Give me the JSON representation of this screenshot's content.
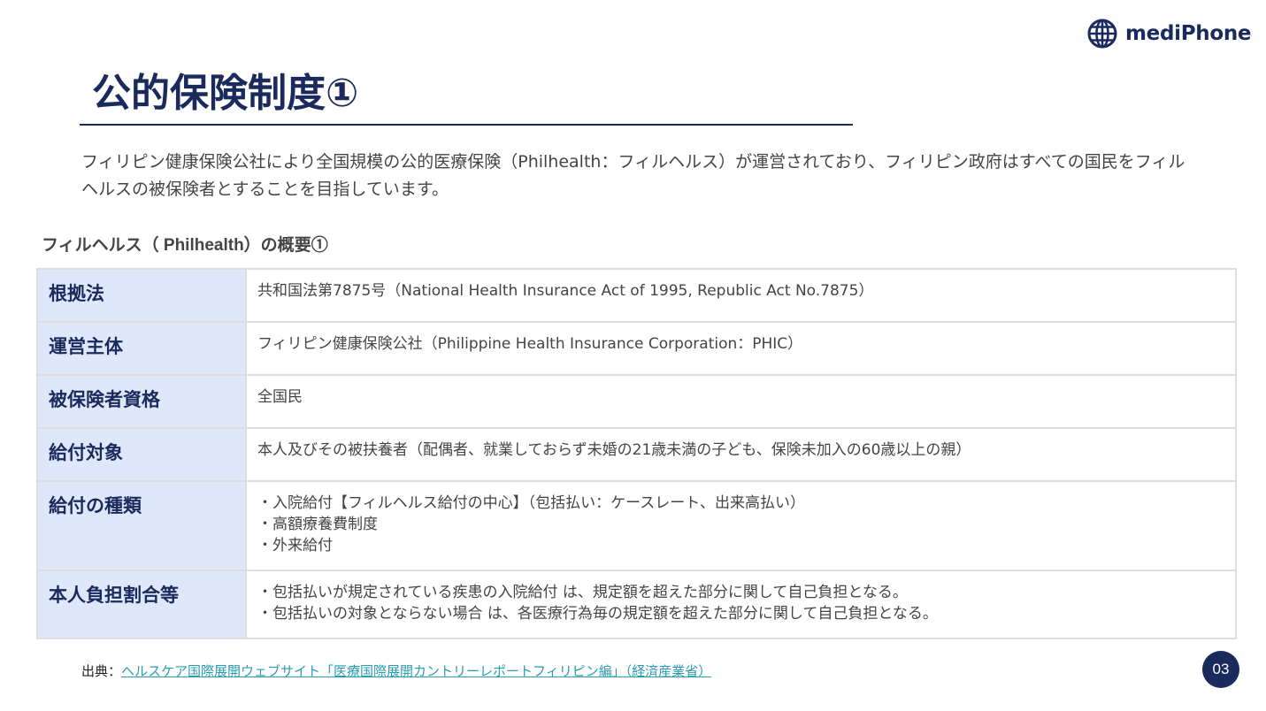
{
  "brand": {
    "name": "mediPhone",
    "icon": "globe-icon",
    "color": "#1b2a5c"
  },
  "page": {
    "title": "公的保険制度①",
    "intro": "フィリピン健康保険公社により全国規模の公的医療保険（Philhealth：フィルヘルス）が運営されており、フィリピン政府はすべての国民をフィルヘルスの被保険者とすることを目指しています。",
    "section_heading": "フィルヘルス（ Philhealth）の概要①",
    "page_number": "03"
  },
  "table": {
    "rows": [
      {
        "label": "根拠法",
        "lines": [
          "共和国法第7875号（National Health Insurance Act of 1995, Republic Act No.7875）"
        ]
      },
      {
        "label": "運営主体",
        "lines": [
          "フィリピン健康保険公社（Philippine Health Insurance Corporation：PHIC）"
        ]
      },
      {
        "label": "被保険者資格",
        "lines": [
          "全国民"
        ]
      },
      {
        "label": "給付対象",
        "lines": [
          "本人及びその被扶養者（配偶者、就業しておらず未婚の21歳未満の子ども、保険未加入の60歳以上の親）"
        ]
      },
      {
        "label": "給付の種類",
        "lines": [
          "・入院給付【フィルヘルス給付の中心】（包括払い：ケースレート、出来高払い）",
          "・高額療養費制度",
          "・外来給付"
        ]
      },
      {
        "label": "本人負担割合等",
        "lines": [
          "・包括払いが規定されている疾患の入院給付 は、規定額を超えた部分に関して自己負担となる。",
          "・包括払いの対象とならない場合 は、各医療行為毎の規定額を超えた部分に関して自己負担となる。"
        ]
      }
    ]
  },
  "source": {
    "prefix": "出典：",
    "link_text": "ヘルスケア国際展開ウェブサイト「医療国際展開カントリーレポートフィリピン編」（経済産業省）"
  },
  "colors": {
    "navy": "#1b2a5c",
    "label_bg": "#dfe8fb",
    "border": "#dedede",
    "link": "#2a9bb4"
  }
}
